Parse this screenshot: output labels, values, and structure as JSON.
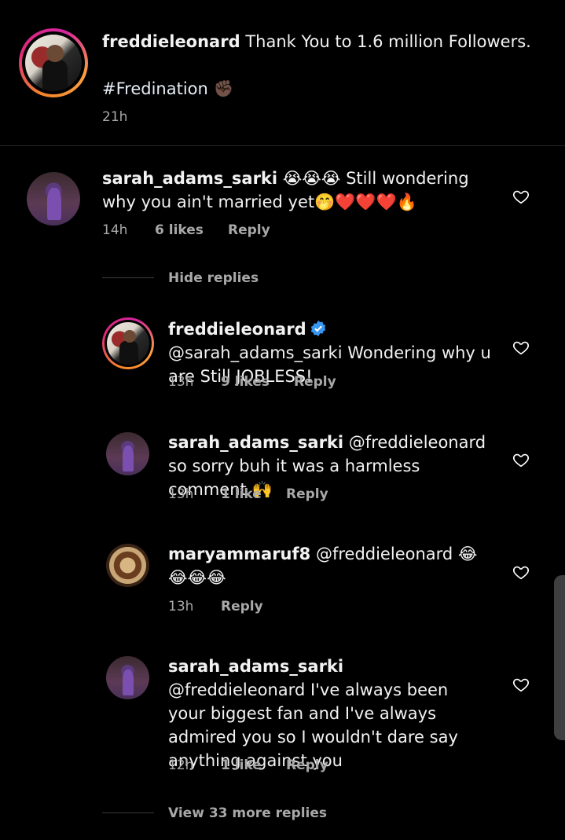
{
  "post": {
    "username": "freddieleonard",
    "caption": "Thank You to 1.6 million Followers.",
    "hashtag": "#Fredination",
    "hashtag_emoji": "✊🏿",
    "time": "21h"
  },
  "comments": [
    {
      "username": "sarah_adams_sarki",
      "text": "😭😭😭 Still wondering why you ain't married yet🤭❤️❤️❤️🔥",
      "time": "14h",
      "likes": "6 likes",
      "reply": "Reply"
    }
  ],
  "hide_replies": "Hide replies",
  "replies": [
    {
      "username": "freddieleonard",
      "mention": "@sarah_adams_sarki",
      "text": "Wondering why u are Still  JOBLESS!",
      "time": "13h",
      "likes": "9 likes",
      "reply": "Reply"
    },
    {
      "username": "sarah_adams_sarki",
      "mention": "@freddieleonard",
      "text": "so sorry buh it was a harmless comment 🙌",
      "time": "13h",
      "likes": "1 like",
      "reply": "Reply"
    },
    {
      "username": "maryammaruf8",
      "mention": "@freddieleonard",
      "text": "😂😂😂😂",
      "time": "13h",
      "reply": "Reply"
    },
    {
      "username": "sarah_adams_sarki",
      "mention": "@freddieleonard",
      "text": "I've always been your biggest fan and I've always admired you so I wouldn't dare say anything against you",
      "time": "12h",
      "likes": "1 like",
      "reply": "Reply"
    }
  ],
  "view_more": "View 33 more replies",
  "colors": {
    "background": "#000000",
    "meta": "#a8a8a8",
    "verified": "#3897f0"
  }
}
